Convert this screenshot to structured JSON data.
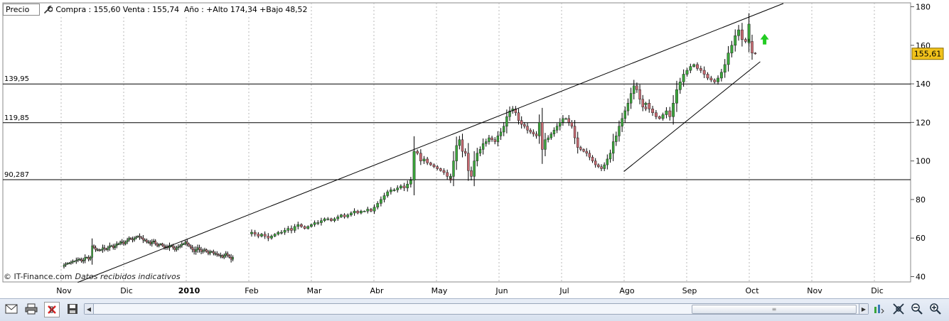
{
  "header": {
    "mode_label": "Precio",
    "quote_text": "Compra : 155,60 Venta : 155,74  Año : +Alto 174,34 +Bajo 48,52"
  },
  "footer": {
    "credit": "© IT-Finance.com",
    "source_note": "Datos recibidos indicativos"
  },
  "toolbar": {
    "icons": [
      "mail-icon",
      "print-icon",
      "disable-indicators-icon",
      "save-icon",
      "scroll-left-icon",
      "scroll-right-icon",
      "chart-settings-icon",
      "fit-icon",
      "zoom-out-icon",
      "zoom-in-icon"
    ]
  },
  "colors": {
    "up_candle": "#3aa63a",
    "down_candle": "#c86a72",
    "wick": "#000000",
    "price_badge": "#f1c21b",
    "arrow": "#22cc22"
  },
  "chart_data": {
    "type": "candlestick",
    "ylim": [
      40,
      182
    ],
    "y_ticks": [
      40,
      60,
      80,
      100,
      120,
      140,
      160,
      180
    ],
    "x_labels": [
      "Nov",
      "Dic",
      "2010",
      "Feb",
      "Mar",
      "Abr",
      "May",
      "Jun",
      "Jul",
      "Ago",
      "Sep",
      "Oct",
      "Nov",
      "Dic"
    ],
    "last_price": "155,61",
    "horizontal_levels": [
      {
        "label": "139,95",
        "value": 139.95
      },
      {
        "label": "119,85",
        "value": 119.85
      },
      {
        "label": "90,287",
        "value": 90.287
      }
    ],
    "trendlines": [
      {
        "from": [
          0.22,
          37
        ],
        "to": [
          11.5,
          181.7
        ]
      },
      {
        "from": [
          8.95,
          94.5
        ],
        "to": [
          11.13,
          151.5
        ]
      }
    ],
    "signal": "up-arrow",
    "segments": [
      {
        "start": 0.0,
        "end": 2.7,
        "closes": [
          46,
          46.5,
          47,
          47,
          47.5,
          48,
          48,
          48.5,
          49,
          49,
          48,
          48.5,
          50,
          50,
          49,
          50,
          56,
          55,
          54,
          54,
          53.5,
          54,
          55,
          54.5,
          54,
          55,
          56,
          56,
          55,
          56,
          57,
          57,
          58,
          58,
          57,
          58,
          59,
          60,
          59.5,
          59,
          60,
          60.5,
          61,
          60.5,
          60,
          59,
          59,
          58,
          58,
          57,
          58,
          58.5,
          57,
          56,
          56.5,
          57,
          56,
          55,
          55.5,
          55,
          56,
          56,
          55,
          54,
          55,
          55.5,
          56,
          57,
          57,
          58,
          57,
          56,
          55,
          54,
          53,
          54,
          55,
          54,
          53,
          53.5,
          54,
          53,
          52,
          53,
          53,
          52,
          52,
          51.5,
          51,
          51,
          50,
          51,
          52,
          51,
          50,
          49,
          50
        ]
      },
      {
        "start": 3.0,
        "end": 6.18,
        "closes": [
          63,
          62,
          61,
          62,
          61,
          60,
          61,
          62,
          63,
          63,
          64,
          65,
          64,
          66,
          67,
          66,
          65,
          66,
          67,
          68,
          68,
          69,
          70,
          70,
          69,
          70,
          71,
          72,
          71,
          72,
          73,
          74,
          73,
          74,
          74,
          75,
          74,
          76,
          78,
          80,
          82,
          84,
          85,
          85,
          86,
          87,
          86,
          88,
          90,
          105,
          104,
          100,
          101,
          99,
          98,
          97,
          96,
          95,
          94,
          92,
          90
        ]
      },
      {
        "start": 6.18,
        "end": 9.3,
        "closes": [
          92,
          100,
          108,
          111,
          105,
          104,
          95,
          92,
          100,
          104,
          106,
          109,
          110,
          112,
          111,
          110,
          113,
          115,
          118,
          123,
          126,
          127,
          125,
          121,
          119,
          118,
          116,
          115,
          114,
          113,
          120,
          106,
          111,
          112,
          114,
          116,
          118,
          120,
          122,
          122,
          120,
          118,
          112,
          107,
          106,
          105,
          104,
          102,
          100,
          98,
          97,
          96,
          98,
          101,
          104,
          110,
          113,
          118,
          122,
          126,
          130,
          135,
          139,
          137,
          132,
          128,
          127
        ]
      },
      {
        "start": 9.3,
        "end": 10.95,
        "closes": [
          130,
          127,
          125,
          123,
          122,
          124,
          126,
          123,
          130,
          137,
          141,
          145,
          147,
          149,
          150,
          148,
          147,
          145,
          143,
          142,
          141,
          143,
          146,
          150,
          156,
          160,
          165,
          168,
          163,
          162,
          171
        ]
      },
      {
        "start": 10.95,
        "end": 11.05,
        "closes": [
          162,
          156,
          155.61
        ]
      }
    ]
  }
}
